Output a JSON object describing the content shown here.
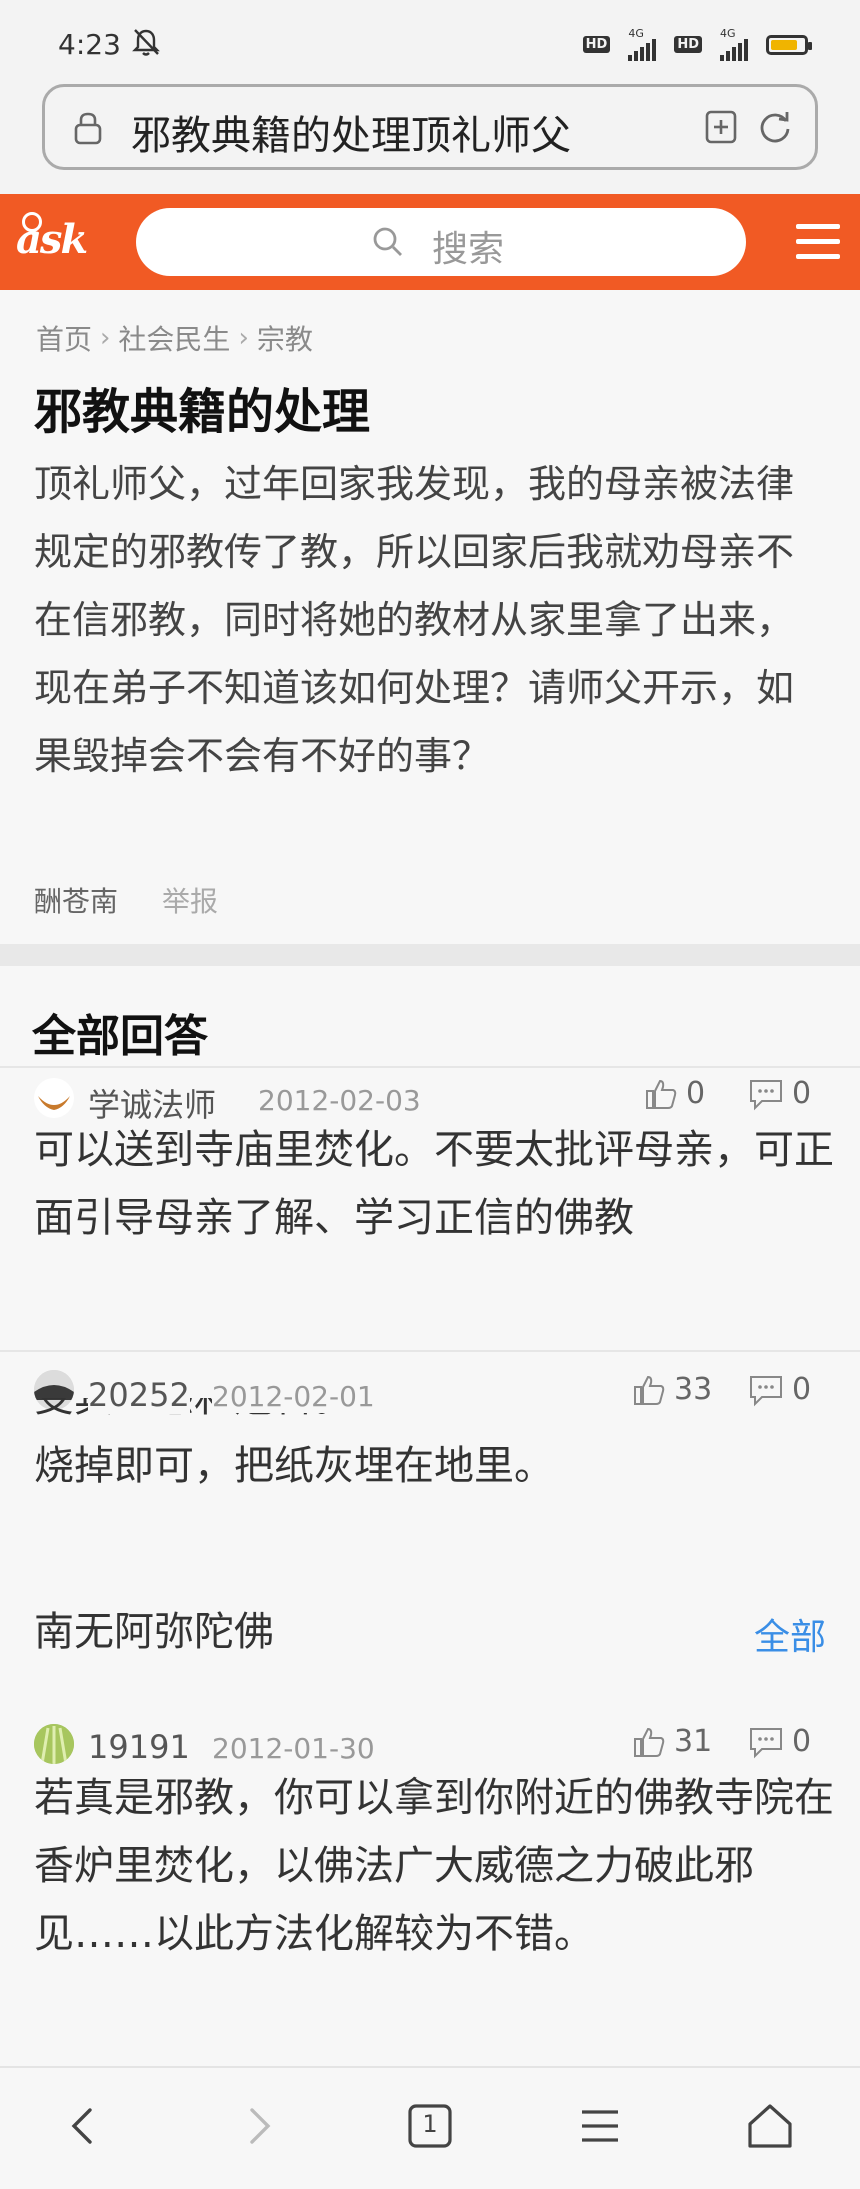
{
  "status_bar": {
    "time": "4:23",
    "badges": [
      "HD",
      "HD"
    ],
    "network_labels": [
      "4G",
      "4G"
    ],
    "battery_level": 0.8,
    "battery_color": "#f0b400"
  },
  "url_bar": {
    "text": "邪教典籍的处理顶礼师父"
  },
  "site": {
    "logo_text": "ask",
    "brand_color": "#f15a24",
    "search_placeholder": "搜索"
  },
  "breadcrumb": [
    "首页",
    "社会民生",
    "宗教"
  ],
  "question": {
    "title": "邪教典籍的处理",
    "body": "顶礼师父，过年回家我发现，我的母亲被法律规定的邪教传了教，所以回家后我就劝母亲不在信邪教，同时将她的教材从家里拿了出来，现在弟子不知道该如何处理？请师父开示，如果毁掉会不会有不好的事？",
    "author": "酬苍南",
    "report_label": "举报"
  },
  "answers_section": {
    "title": "全部回答",
    "answers": [
      {
        "user": "学诚法师",
        "date": "2012-02-03",
        "likes": "0",
        "comments": "0",
        "text": "可以送到寺庙里焚化。不要太批评母亲，可正面引导母亲了解、学习正信的佛教"
      },
      {
        "user": "20252",
        "date": "2012-02-01",
        "likes": "33",
        "comments": "0",
        "text_partial": "受其蛊惑和危害。",
        "text": "烧掉即可，把纸灰埋在地里。",
        "text_2": "南无阿弥陀佛",
        "see_all": "全部"
      },
      {
        "user": "19191",
        "date": "2012-01-30",
        "likes": "31",
        "comments": "0",
        "text": "若真是邪教，你可以拿到你附近的佛教寺院在香炉里焚化，以佛法广大威德之力破此邪见……以此方法化解较为不错。"
      }
    ]
  },
  "bottom_nav": {
    "tab_count": "1"
  }
}
